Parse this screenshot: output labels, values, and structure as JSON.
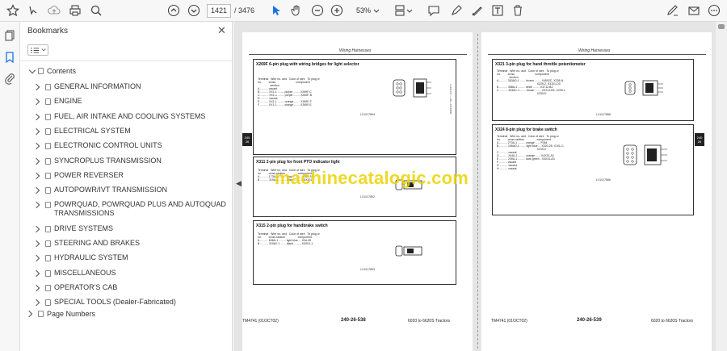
{
  "toolbar": {
    "page_current": "1421",
    "page_total": "/ 3476",
    "zoom": "53%"
  },
  "bookmarks": {
    "title": "Bookmarks",
    "close": "✕",
    "contents_label": "Contents",
    "items": [
      {
        "label": "GENERAL INFORMATION"
      },
      {
        "label": "ENGINE"
      },
      {
        "label": "FUEL, AIR INTAKE AND COOLING SYSTEMS"
      },
      {
        "label": "ELECTRICAL SYSTEM"
      },
      {
        "label": "ELECTRONIC CONTROL UNITS"
      },
      {
        "label": "SYNCROPLUS TRANSMISSION"
      },
      {
        "label": "POWER REVERSER"
      },
      {
        "label": "AUTOPOWR/IVT TRANSMISSION"
      },
      {
        "label": "POWRQUAD, POWRQUAD PLUS AND AUTOQUAD",
        "label2": "TRANSMISSIONS"
      },
      {
        "label": "DRIVE SYSTEMS"
      },
      {
        "label": "STEERING AND BRAKES"
      },
      {
        "label": "HYDRAULIC SYSTEM"
      },
      {
        "label": "MISCELLANEOUS"
      },
      {
        "label": "OPERATOR'S CAB"
      },
      {
        "label": "SPECIAL TOOLS (Dealer-Fabricated)"
      }
    ],
    "page_numbers_label": "Page Numbers"
  },
  "document": {
    "watermark": "machinecatalogic.com",
    "left_page": {
      "header": "Wiring Harnesses",
      "box1_title": "X269F 6-pin plug with wiring bridges for light selector",
      "box1_ref": "LX1017894",
      "box2_title": "X311 2-pin plug for front PTO indicator light",
      "box2_ref": "LX1017892",
      "box3_title": "X315 2-pin plug for handbrake switch",
      "box3_ref": "LX1017893",
      "footer_left": "TM4741 (01OCT02)",
      "footer_center": "240-26-538",
      "footer_right": "6020 to 6620S Tractors",
      "tab": "240 26"
    },
    "right_page": {
      "header": "Wiring Harnesses",
      "box1_title": "X321 3-pin plug for hand throttle potentiometer",
      "box1_ref": "LX1017888",
      "box2_title": "X324 8-pin plug for brake switch",
      "box2_ref": "LX1017886",
      "footer_left": "TM4741 (01OCT02)",
      "footer_center": "240-26-539",
      "footer_right": "6020 to 6620S Tractors",
      "tab": "240 26"
    }
  }
}
